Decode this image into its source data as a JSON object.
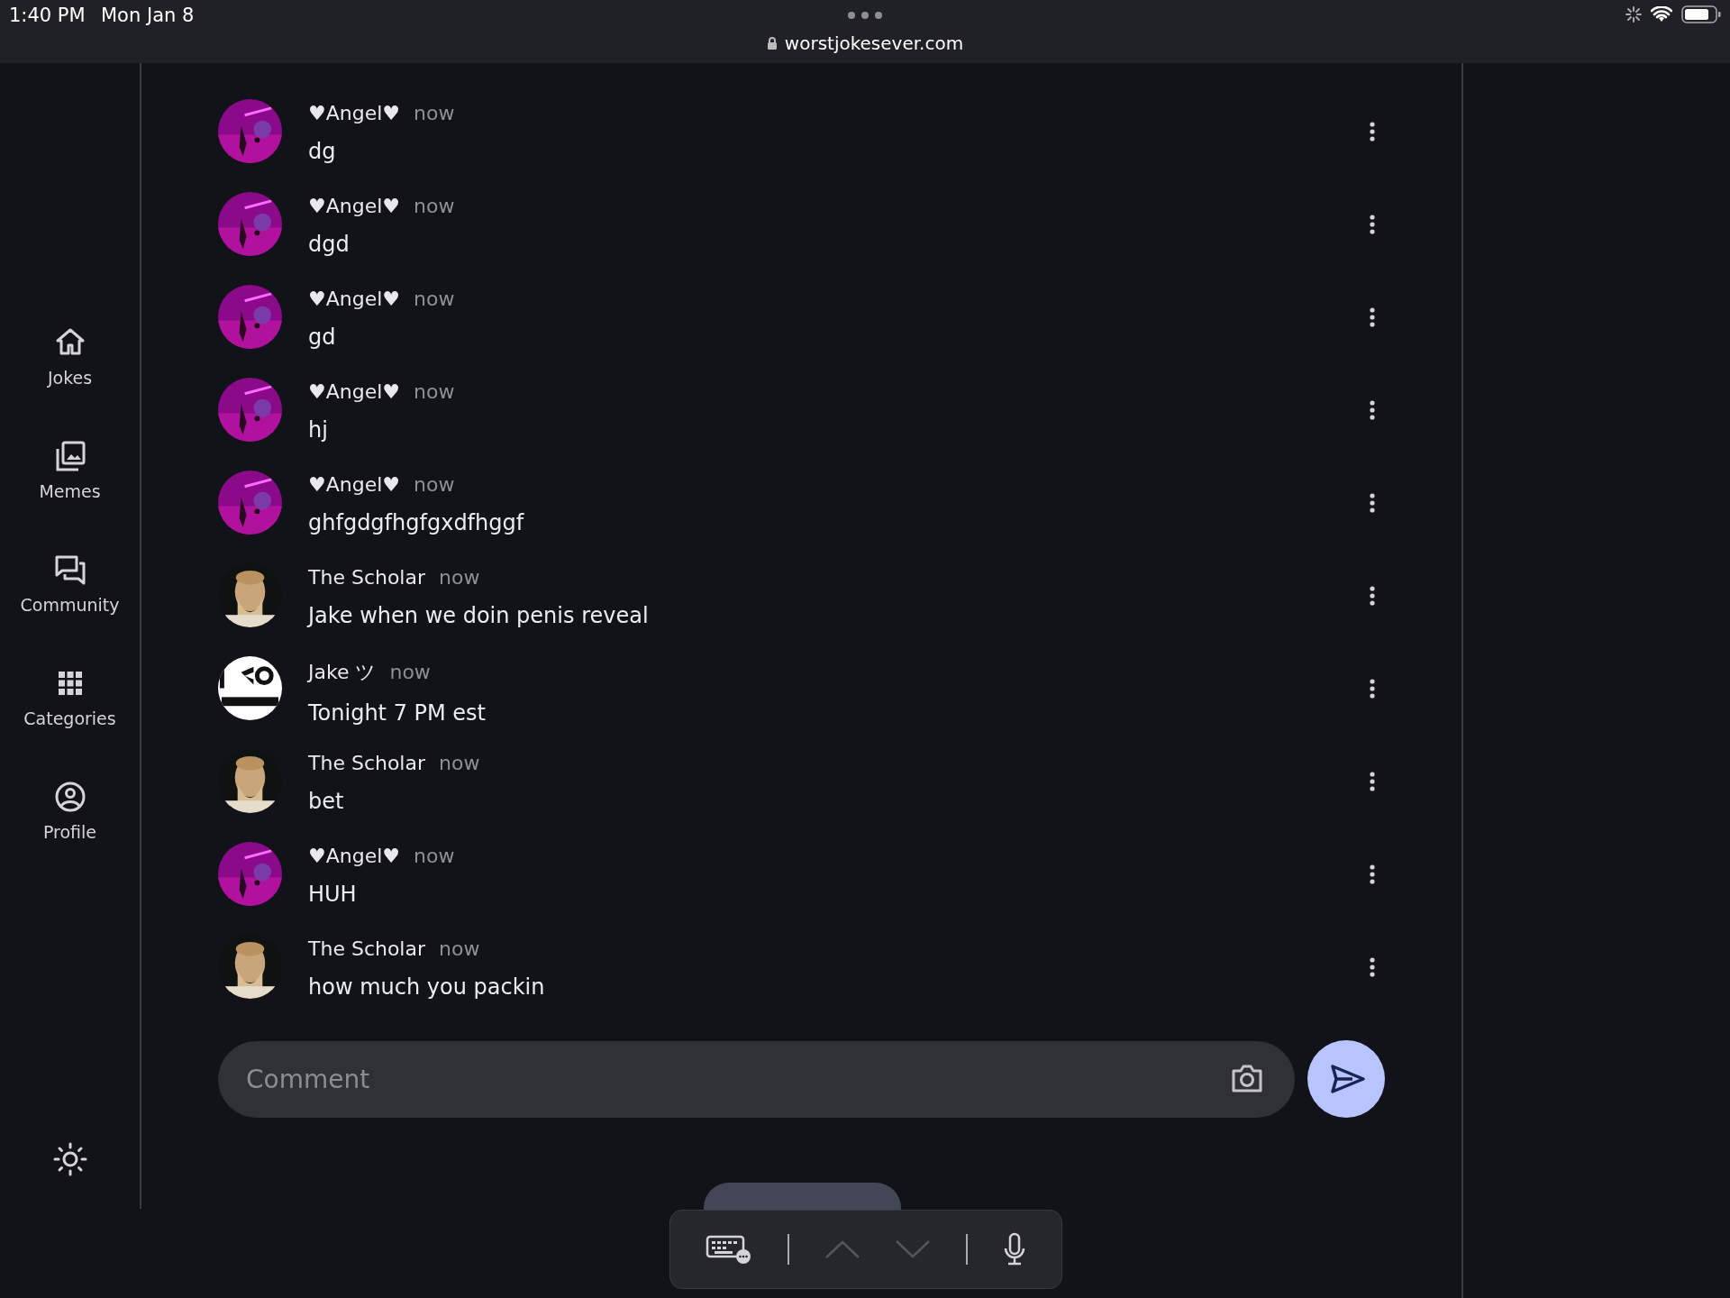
{
  "status_bar": {
    "time": "1:40 PM",
    "date": "Mon Jan 8",
    "url": "worstjokesever.com"
  },
  "sidebar": {
    "items": [
      {
        "label": "Jokes",
        "kind": "home"
      },
      {
        "label": "Memes",
        "kind": "images"
      },
      {
        "label": "Community",
        "kind": "chat"
      },
      {
        "label": "Categories",
        "kind": "grid"
      },
      {
        "label": "Profile",
        "kind": "profile"
      }
    ]
  },
  "comments": [
    {
      "author": "♥Angel♥",
      "time": "now",
      "text": "dg"
    },
    {
      "author": "♥Angel♥",
      "time": "now",
      "text": "dgd"
    },
    {
      "author": "♥Angel♥",
      "time": "now",
      "text": "gd"
    },
    {
      "author": "♥Angel♥",
      "time": "now",
      "text": "hj"
    },
    {
      "author": "♥Angel♥",
      "time": "now",
      "text": "ghfgdgfhgfgxdfhggf"
    },
    {
      "author": "The Scholar",
      "time": "now",
      "text": "Jake when we doin penis reveal"
    },
    {
      "author": "Jake ツ",
      "time": "now",
      "text": "Tonight 7 PM est"
    },
    {
      "author": "The Scholar",
      "time": "now",
      "text": "bet"
    },
    {
      "author": "♥Angel♥",
      "time": "now",
      "text": "HUH"
    },
    {
      "author": "The Scholar",
      "time": "now",
      "text": "how much you packin"
    }
  ],
  "comment_field": {
    "placeholder": "Comment"
  }
}
